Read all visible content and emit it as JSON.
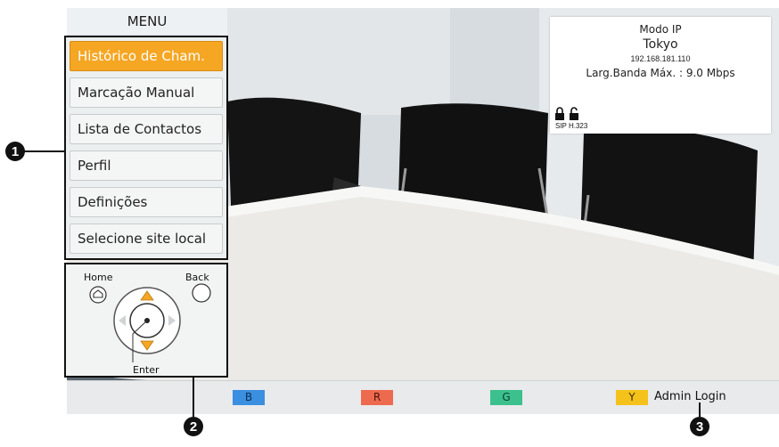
{
  "menu": {
    "title": "MENU",
    "items": [
      {
        "label": "Histórico de Cham.",
        "active": true
      },
      {
        "label": "Marcação Manual",
        "active": false
      },
      {
        "label": "Lista de Contactos",
        "active": false
      },
      {
        "label": "Perfil",
        "active": false
      },
      {
        "label": "Definições",
        "active": false
      },
      {
        "label": "Selecione site local",
        "active": false
      }
    ]
  },
  "remote": {
    "home_label": "Home",
    "back_label": "Back",
    "enter_label": "Enter"
  },
  "status": {
    "mode": "Modo IP",
    "site": "Tokyo",
    "ip": "192.168.181.110",
    "bandwidth": "Larg.Banda Máx. : 9.0 Mbps",
    "protocols": "SIP H.323"
  },
  "bottom_bar": {
    "keys": [
      {
        "label": "B",
        "color": "#3b8fe0"
      },
      {
        "label": "R",
        "color": "#ee6a4f"
      },
      {
        "label": "G",
        "color": "#3cc08d"
      },
      {
        "label": "Y",
        "color": "#f4c21b"
      }
    ],
    "admin_login": "Admin Login"
  },
  "callouts": [
    "1",
    "2",
    "3"
  ]
}
